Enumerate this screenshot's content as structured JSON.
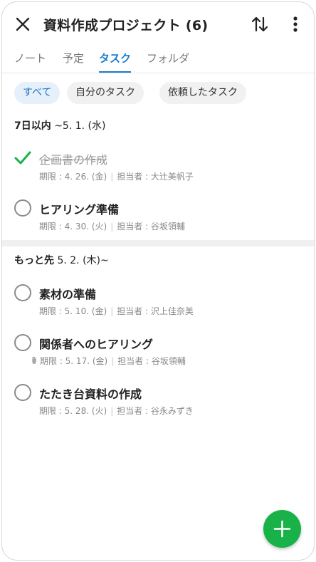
{
  "header": {
    "title": "資料作成プロジェクト (6)",
    "close_icon": "close-icon",
    "sort_icon": "sort-icon",
    "more_icon": "more-vertical-icon"
  },
  "tabs": [
    {
      "label": "ノート",
      "active": false
    },
    {
      "label": "予定",
      "active": false
    },
    {
      "label": "タスク",
      "active": true
    },
    {
      "label": "フォルダ",
      "active": false
    }
  ],
  "filters": [
    {
      "label": "すべて",
      "active": true
    },
    {
      "label": "自分のタスク",
      "active": false
    },
    {
      "label": "依頼したタスク",
      "active": false
    }
  ],
  "sections": [
    {
      "header_bold": "7日以内",
      "header_rest": " ~5. 1. (水)",
      "tasks": [
        {
          "title": "企画書の作成",
          "done": true,
          "due": "期限 : 4. 26. (金)",
          "assignee": "担当者 : 大辻美帆子",
          "attachment": false
        },
        {
          "title": "ヒアリング準備",
          "done": false,
          "due": "期限 : 4. 30. (火)",
          "assignee": "担当者 : 谷坂領輔",
          "attachment": false
        }
      ]
    },
    {
      "header_bold": "もっと先",
      "header_rest": " 5. 2. (木)~",
      "tasks": [
        {
          "title": "素材の準備",
          "done": false,
          "due": "期限 : 5. 10. (金)",
          "assignee": "担当者 : 沢上佳奈美",
          "attachment": false
        },
        {
          "title": "関係者へのヒアリング",
          "done": false,
          "due": "期限 : 5. 17. (金)",
          "assignee": "担当者 : 谷坂領輔",
          "attachment": true
        },
        {
          "title": "たたき台資料の作成",
          "done": false,
          "due": "期限 : 5. 28. (火)",
          "assignee": "担当者 : 谷永みずき",
          "attachment": false
        }
      ]
    }
  ],
  "fab": {
    "icon": "plus-icon",
    "color": "#19b249"
  },
  "colors": {
    "accent": "#1a7ccf",
    "done_check": "#19b249"
  }
}
